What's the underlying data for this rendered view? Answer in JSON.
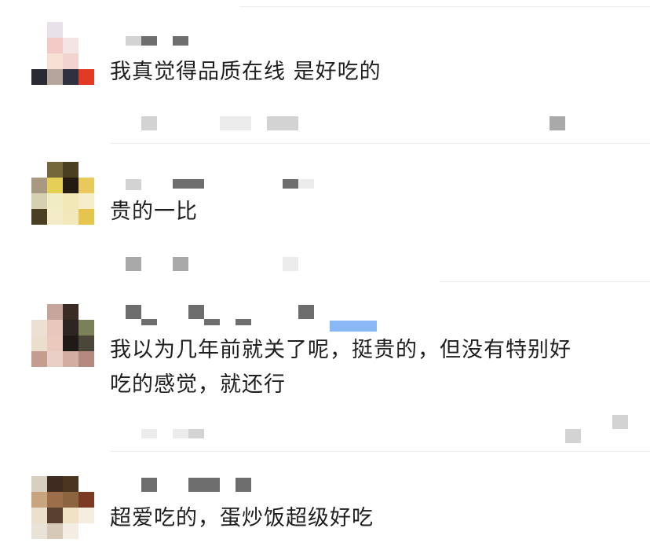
{
  "comments": [
    {
      "text": "我真觉得品质在线 是好吃的"
    },
    {
      "text": "贵的一比"
    },
    {
      "text": "我以为几年前就关了呢，挺贵的，但没有特别好\n吃的感觉，就还行"
    },
    {
      "text": "超爱吃的，蛋炒饭超级好吃"
    }
  ],
  "colors": {
    "text": "#1e1e1e",
    "divider": "#ececec",
    "blurred_name": "#6e6e6e",
    "accent": "#8ab7f5"
  }
}
